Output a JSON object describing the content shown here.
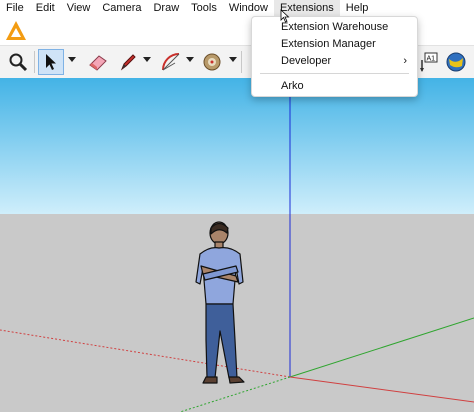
{
  "menubar": {
    "items": [
      "File",
      "Edit",
      "View",
      "Camera",
      "Draw",
      "Tools",
      "Window",
      "Extensions",
      "Help"
    ]
  },
  "extensions_menu": {
    "items": [
      {
        "label": "Extension Warehouse",
        "submenu": false
      },
      {
        "label": "Extension Manager",
        "submenu": false
      },
      {
        "label": "Developer",
        "submenu": true
      },
      {
        "label": "Arko",
        "submenu": false
      }
    ],
    "submenu_arrow": "›"
  },
  "toolbar": {
    "icons": [
      "zoom-icon",
      "select-arrow-icon",
      "eraser-icon",
      "pencil-icon",
      "arc-icon",
      "paint-bucket-icon",
      "text-icon",
      "globe-icon"
    ],
    "partial_label": "A1"
  },
  "colors": {
    "sky_top": "#43b3e6",
    "ground": "#c9c9c9",
    "blue_axis": "#1a2cd6",
    "red_axis": "#d04040",
    "green_axis": "#2fa52f",
    "logo": "#f39c12"
  }
}
